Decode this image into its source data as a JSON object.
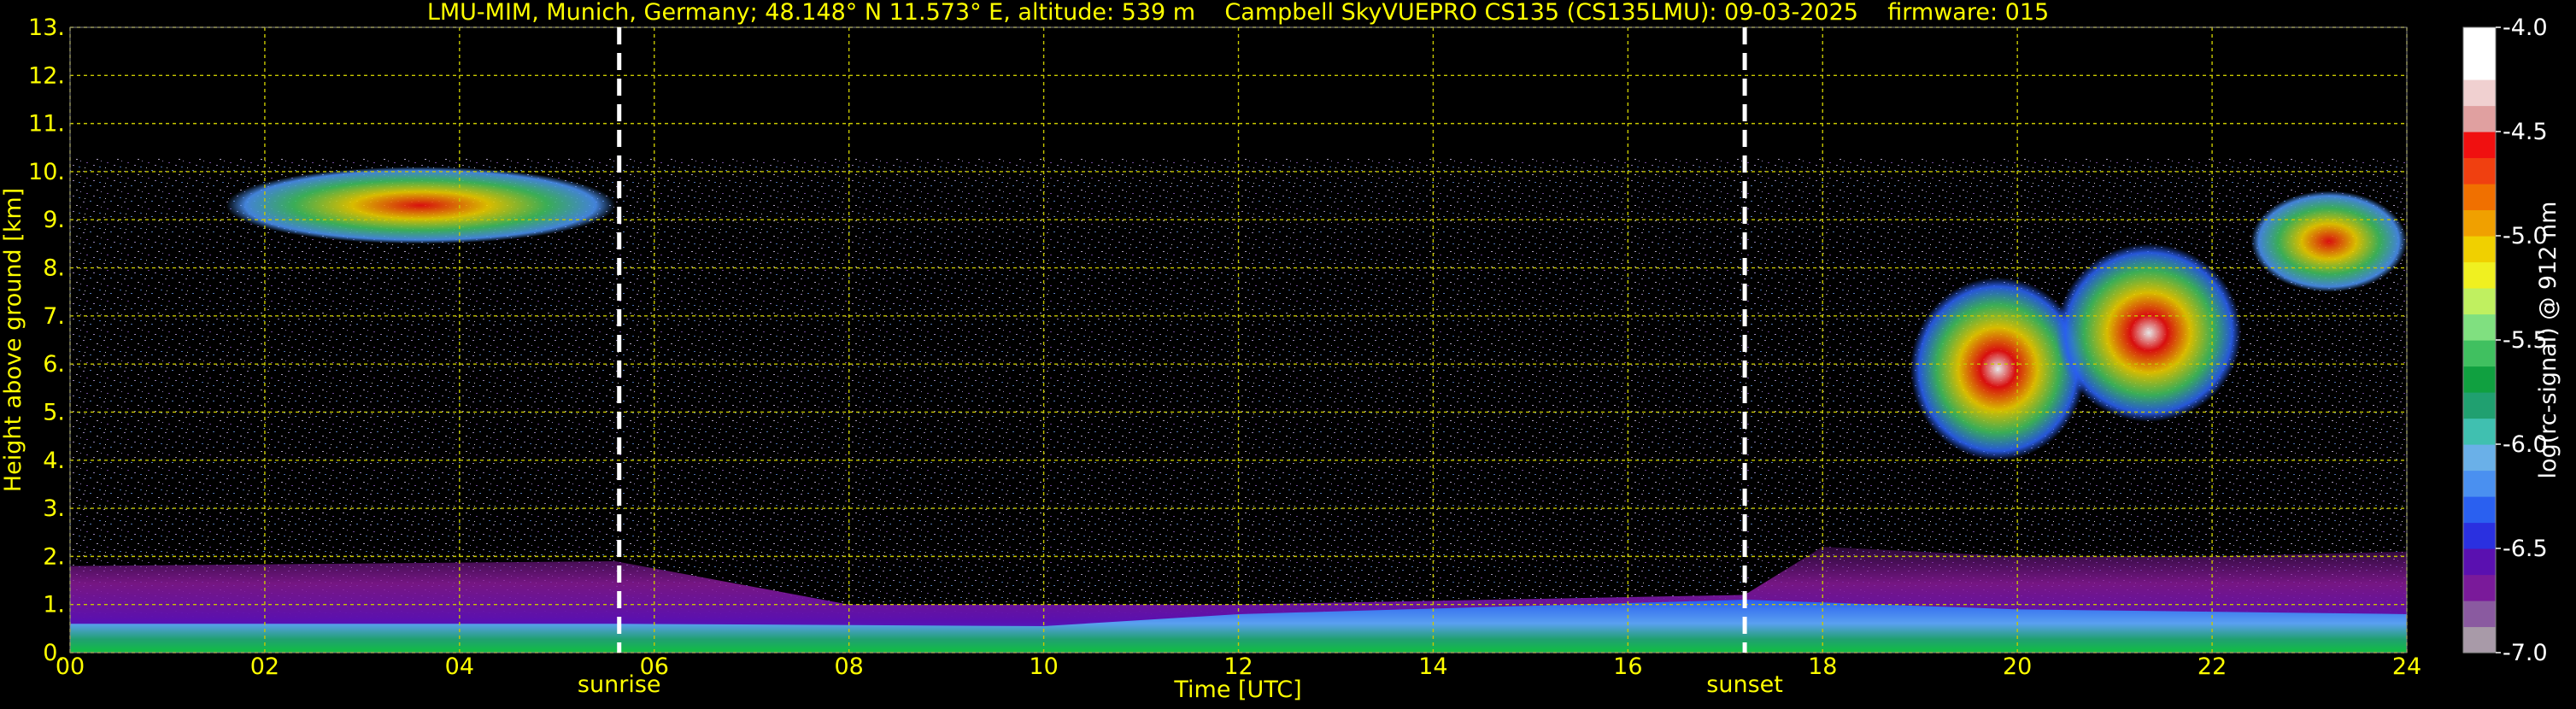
{
  "chart_data": {
    "type": "heatmap",
    "title": "LMU-MIM, Munich, Germany; 48.148° N 11.573° E, altitude: 539 m    Campbell SkyVUEPRO CS135 (CS135LMU): 09-03-2025    firmware: 015",
    "xlabel": "Time [UTC]",
    "ylabel": "Height above ground [km]",
    "colorbar_label": "log(rc-signal) @ 912 nm",
    "xlim": [
      0,
      24
    ],
    "ylim": [
      0,
      13
    ],
    "clim": [
      -7.0,
      -4.0
    ],
    "grid": true,
    "x_ticks": [
      {
        "v": 0,
        "label": "00"
      },
      {
        "v": 2,
        "label": "02"
      },
      {
        "v": 4,
        "label": "04"
      },
      {
        "v": 6,
        "label": "06"
      },
      {
        "v": 8,
        "label": "08"
      },
      {
        "v": 10,
        "label": "10"
      },
      {
        "v": 12,
        "label": "12"
      },
      {
        "v": 14,
        "label": "14"
      },
      {
        "v": 16,
        "label": "16"
      },
      {
        "v": 18,
        "label": "18"
      },
      {
        "v": 20,
        "label": "20"
      },
      {
        "v": 22,
        "label": "22"
      },
      {
        "v": 24,
        "label": "24"
      }
    ],
    "y_ticks": [
      {
        "v": 0,
        "label": "0."
      },
      {
        "v": 1,
        "label": "1."
      },
      {
        "v": 2,
        "label": "2."
      },
      {
        "v": 3,
        "label": "3."
      },
      {
        "v": 4,
        "label": "4."
      },
      {
        "v": 5,
        "label": "5."
      },
      {
        "v": 6,
        "label": "6."
      },
      {
        "v": 7,
        "label": "7."
      },
      {
        "v": 8,
        "label": "8."
      },
      {
        "v": 9,
        "label": "9."
      },
      {
        "v": 10,
        "label": "10."
      },
      {
        "v": 11,
        "label": "11."
      },
      {
        "v": 12,
        "label": "12."
      },
      {
        "v": 13,
        "label": "13."
      }
    ],
    "colorbar_ticks": [
      {
        "v": -4.0,
        "label": "-4.0"
      },
      {
        "v": -4.5,
        "label": "-4.5"
      },
      {
        "v": -5.0,
        "label": "-5.0"
      },
      {
        "v": -5.5,
        "label": "-5.5"
      },
      {
        "v": -6.0,
        "label": "-6.0"
      },
      {
        "v": -6.5,
        "label": "-6.5"
      },
      {
        "v": -7.0,
        "label": "-7.0"
      }
    ],
    "annotations": [
      {
        "text": "sunrise",
        "x": 5.64
      },
      {
        "text": "sunset",
        "x": 17.2
      }
    ],
    "noise_top_km": 10.3,
    "layers": [
      {
        "name": "boundary layer high",
        "t": [
          0,
          5.6,
          8,
          12,
          17.2,
          18,
          20,
          22,
          24
        ],
        "h": [
          1.8,
          1.9,
          1.0,
          1.0,
          1.2,
          2.2,
          2.0,
          2.0,
          2.1
        ]
      },
      {
        "name": "aerosol base",
        "t": [
          0,
          5.6,
          10,
          12,
          17.2,
          20,
          24
        ],
        "h": [
          0.6,
          0.6,
          0.55,
          0.8,
          1.1,
          0.9,
          0.8
        ]
      }
    ],
    "clouds": [
      {
        "id": "cirrus-early",
        "t_start": 1.6,
        "t_end": 5.6,
        "h_bottom": 8.5,
        "h_top": 10.1,
        "max_log_signal": -4.8
      },
      {
        "id": "cirrus-evening-a",
        "t_start": 18.9,
        "t_end": 20.7,
        "h_bottom": 4.0,
        "h_top": 7.8,
        "max_log_signal": -4.1
      },
      {
        "id": "cirrus-evening-b",
        "t_start": 20.4,
        "t_end": 22.3,
        "h_bottom": 4.8,
        "h_top": 8.5,
        "max_log_signal": -4.1
      },
      {
        "id": "cirrus-evening-c",
        "t_start": 22.4,
        "t_end": 24.0,
        "h_bottom": 7.5,
        "h_top": 9.6,
        "max_log_signal": -4.8
      }
    ],
    "colors": {
      "background": "#000000",
      "text": "#ffff00",
      "grid": "#c8c800",
      "marker": "#ffffff",
      "colorbar_axis_text": "#ffffff"
    },
    "colormap": [
      "#a89aa8",
      "#8a5aa0",
      "#7a1a9a",
      "#5a10b0",
      "#2a30e0",
      "#2a60f0",
      "#4a90f0",
      "#6ab0e8",
      "#40c0b0",
      "#20a070",
      "#10a040",
      "#40c060",
      "#80e080",
      "#c0f060",
      "#f0f020",
      "#f0d000",
      "#f0a000",
      "#f07000",
      "#f04010",
      "#f01010",
      "#e0a0a0",
      "#f0d0d0",
      "#ffffff",
      "#ffffff"
    ]
  }
}
